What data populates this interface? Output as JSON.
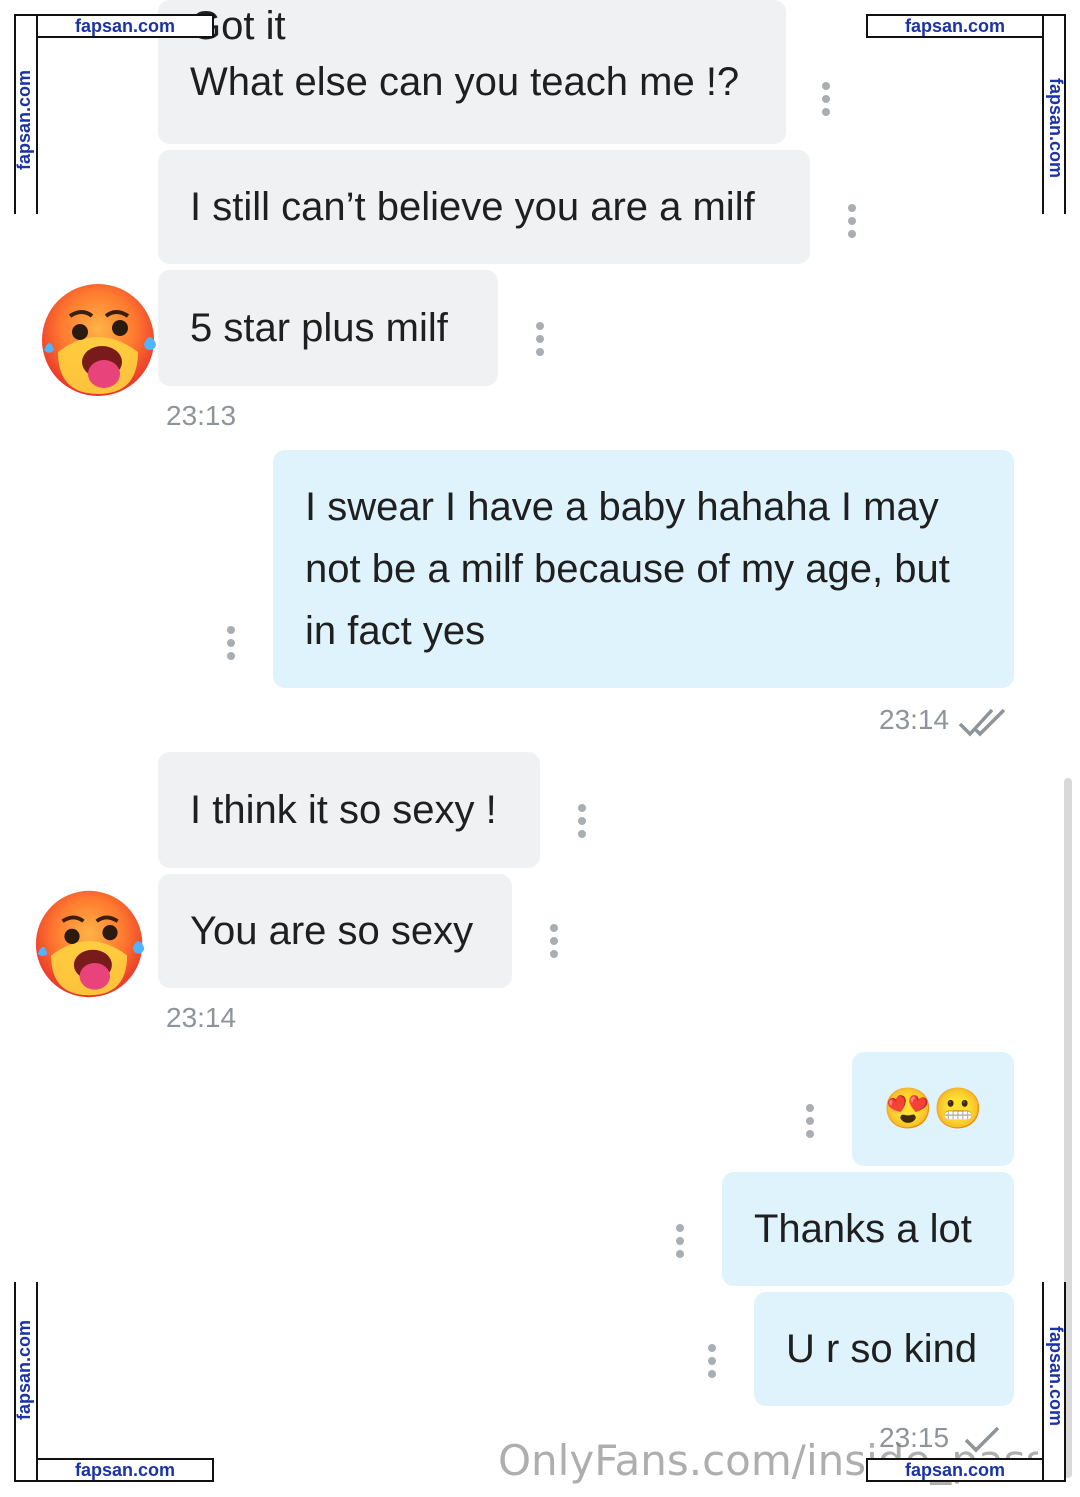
{
  "messages": {
    "m1_line1": "Got it",
    "m1_line2": "What else can you teach me !?",
    "m2": "I still can’t believe you are a milf",
    "m3": "5 star plus milf",
    "t1": "23:13",
    "m4_line1": "I swear I have a baby hahaha I may",
    "m4_line2": "not be a milf because of my age, but",
    "m4_line3": "in fact yes",
    "t2": "23:14",
    "m5": "I think it so sexy !",
    "m6": "You are so sexy",
    "t3": "23:14",
    "m7": "😍😬",
    "m8": "Thanks a lot",
    "m9": "U r so kind",
    "t4": "23:15"
  },
  "icons": {
    "avatar": "hot-face-emoji-icon",
    "menu": "vertical-dots-icon",
    "read": "double-check-icon",
    "sent": "check-icon"
  },
  "colors": {
    "incoming_bubble": "#eff1f3",
    "outgoing_bubble": "#dff3fc",
    "timestamp": "#8d949a"
  },
  "watermarks": {
    "site": "fapsan.com",
    "onlyfans": "OnlyFans.com/inside_passio"
  }
}
